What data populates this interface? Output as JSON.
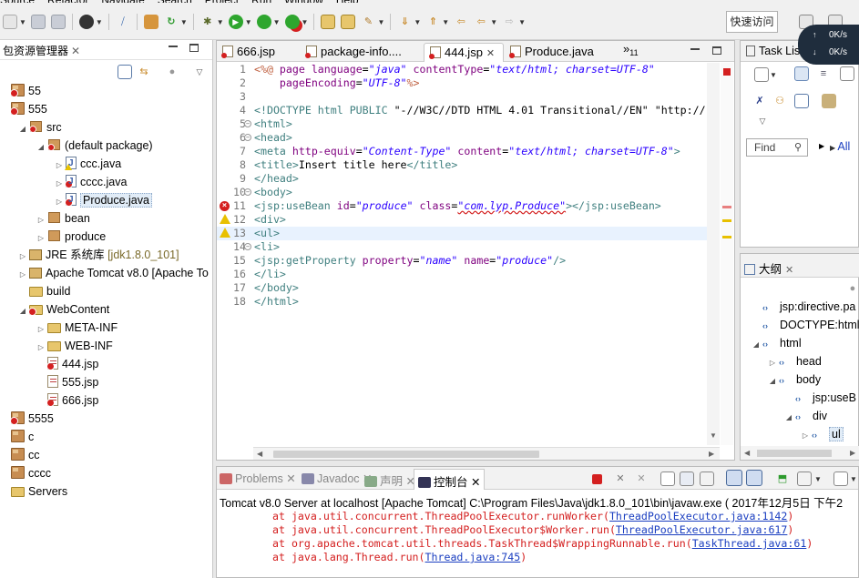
{
  "menu": [
    "Source",
    "Refactor",
    "Navigate",
    "Search",
    "Project",
    "Run",
    "Window",
    "Help"
  ],
  "quick_access": "快速访问",
  "netmon": {
    "up": "0K/s",
    "down": "0K/s"
  },
  "package_explorer": {
    "title": "包资源管理器",
    "tree": [
      {
        "label": "55",
        "indent": 0,
        "icon": "project-error",
        "twisty": ""
      },
      {
        "label": "555",
        "indent": 0,
        "icon": "project-error",
        "twisty": ""
      },
      {
        "label": "src",
        "indent": 1,
        "icon": "package-error",
        "twisty": "open"
      },
      {
        "label": "(default package)",
        "indent": 2,
        "icon": "package-error",
        "twisty": "open"
      },
      {
        "label": "ccc.java",
        "indent": 3,
        "icon": "java-warning",
        "twisty": "closed"
      },
      {
        "label": "cccc.java",
        "indent": 3,
        "icon": "java-error",
        "twisty": "closed"
      },
      {
        "label": "Produce.java",
        "indent": 3,
        "icon": "java-error",
        "twisty": "closed",
        "selected": true
      },
      {
        "label": "bean",
        "indent": 2,
        "icon": "package",
        "twisty": "closed"
      },
      {
        "label": "produce",
        "indent": 2,
        "icon": "package",
        "twisty": "closed"
      },
      {
        "label": "JRE 系统库",
        "suffix": "[jdk1.8.0_101]",
        "indent": 1,
        "icon": "library",
        "twisty": "closed"
      },
      {
        "label": "Apache Tomcat v8.0 [Apache To",
        "indent": 1,
        "icon": "library",
        "twisty": "closed"
      },
      {
        "label": "build",
        "indent": 1,
        "icon": "folder",
        "twisty": ""
      },
      {
        "label": "WebContent",
        "indent": 1,
        "icon": "folder-error",
        "twisty": "open"
      },
      {
        "label": "META-INF",
        "indent": 2,
        "icon": "folder",
        "twisty": "closed"
      },
      {
        "label": "WEB-INF",
        "indent": 2,
        "icon": "folder",
        "twisty": "closed"
      },
      {
        "label": "444.jsp",
        "indent": 2,
        "icon": "jsp-error",
        "twisty": ""
      },
      {
        "label": "555.jsp",
        "indent": 2,
        "icon": "jsp",
        "twisty": ""
      },
      {
        "label": "666.jsp",
        "indent": 2,
        "icon": "jsp-error",
        "twisty": ""
      },
      {
        "label": "5555",
        "indent": 0,
        "icon": "project-error",
        "twisty": ""
      },
      {
        "label": "c",
        "indent": 0,
        "icon": "project",
        "twisty": ""
      },
      {
        "label": "cc",
        "indent": 0,
        "icon": "project",
        "twisty": ""
      },
      {
        "label": "cccc",
        "indent": 0,
        "icon": "project",
        "twisty": ""
      },
      {
        "label": "Servers",
        "indent": 0,
        "icon": "folder",
        "twisty": ""
      }
    ]
  },
  "editor": {
    "tabs": [
      {
        "label": "666.jsp",
        "active": false
      },
      {
        "label": "package-info....",
        "active": false
      },
      {
        "label": "444.jsp",
        "active": true
      },
      {
        "label": "Produce.java",
        "active": false
      }
    ],
    "more_tabs": "»",
    "more_count": "11",
    "lines": [
      {
        "n": "1",
        "fold": false,
        "marker": "",
        "segs": [
          [
            "dir",
            "&lt;%@ "
          ],
          [
            "attr",
            "page "
          ],
          [
            "attr",
            "language"
          ],
          [
            "plain",
            "="
          ],
          [
            "val",
            "\"java\""
          ],
          [
            "plain",
            " "
          ],
          [
            "attr",
            "contentType"
          ],
          [
            "plain",
            "="
          ],
          [
            "val",
            "\"text/html; charset=UTF-8\""
          ]
        ]
      },
      {
        "n": "2",
        "fold": false,
        "marker": "",
        "segs": [
          [
            "plain",
            "    "
          ],
          [
            "attr",
            "pageEncoding"
          ],
          [
            "plain",
            "="
          ],
          [
            "val",
            "\"UTF-8\""
          ],
          [
            "dir",
            "%&gt;"
          ]
        ]
      },
      {
        "n": "3",
        "fold": false,
        "marker": "",
        "segs": []
      },
      {
        "n": "4",
        "fold": false,
        "marker": "",
        "segs": [
          [
            "doct",
            "&lt;!DOCTYPE html PUBLIC "
          ],
          [
            "plain",
            "\"-//W3C//DTD HTML 4.01 Transitional//EN\" \"http://"
          ]
        ]
      },
      {
        "n": "5",
        "fold": true,
        "marker": "",
        "segs": [
          [
            "tag",
            "&lt;html&gt;"
          ]
        ]
      },
      {
        "n": "6",
        "fold": true,
        "marker": "",
        "segs": [
          [
            "tag",
            "&lt;head&gt;"
          ]
        ]
      },
      {
        "n": "7",
        "fold": false,
        "marker": "",
        "segs": [
          [
            "tag",
            "&lt;meta "
          ],
          [
            "attr",
            "http-equiv"
          ],
          [
            "plain",
            "="
          ],
          [
            "val",
            "\"Content-Type\""
          ],
          [
            "plain",
            " "
          ],
          [
            "attr",
            "content"
          ],
          [
            "plain",
            "="
          ],
          [
            "val",
            "\"text/html; charset=UTF-8\""
          ],
          [
            "tag",
            "&gt;"
          ]
        ]
      },
      {
        "n": "8",
        "fold": false,
        "marker": "",
        "segs": [
          [
            "tag",
            "&lt;title&gt;"
          ],
          [
            "plain",
            "Insert title here"
          ],
          [
            "tag",
            "&lt;/title&gt;"
          ]
        ]
      },
      {
        "n": "9",
        "fold": false,
        "marker": "",
        "segs": [
          [
            "tag",
            "&lt;/head&gt;"
          ]
        ]
      },
      {
        "n": "10",
        "fold": true,
        "marker": "",
        "segs": [
          [
            "tag",
            "&lt;body&gt;"
          ]
        ]
      },
      {
        "n": "11",
        "fold": false,
        "marker": "error",
        "segs": [
          [
            "tag",
            "&lt;jsp:useBean "
          ],
          [
            "attr",
            "id"
          ],
          [
            "plain",
            "="
          ],
          [
            "val",
            "\"produce\""
          ],
          [
            "plain",
            " "
          ],
          [
            "attr",
            "class"
          ],
          [
            "plain",
            "="
          ],
          [
            "valsq",
            "\"com.lyp.Produce\""
          ],
          [
            "tag",
            "&gt;&lt;/jsp:useBean&gt;"
          ]
        ]
      },
      {
        "n": "12",
        "fold": false,
        "marker": "warning",
        "segs": [
          [
            "tag",
            "&lt;div&gt;"
          ]
        ]
      },
      {
        "n": "13",
        "fold": false,
        "marker": "warning",
        "current": true,
        "segs": [
          [
            "tag",
            "&lt;ul&gt;"
          ]
        ]
      },
      {
        "n": "14",
        "fold": true,
        "marker": "",
        "segs": [
          [
            "tag",
            "&lt;li&gt;"
          ]
        ]
      },
      {
        "n": "15",
        "fold": false,
        "marker": "",
        "segs": [
          [
            "tag",
            "&lt;jsp:getProperty "
          ],
          [
            "attr",
            "property"
          ],
          [
            "plain",
            "="
          ],
          [
            "val",
            "\"name\""
          ],
          [
            "plain",
            " "
          ],
          [
            "attr",
            "name"
          ],
          [
            "plain",
            "="
          ],
          [
            "val",
            "\"produce\""
          ],
          [
            "tag",
            "/&gt;"
          ]
        ]
      },
      {
        "n": "16",
        "fold": false,
        "marker": "",
        "segs": [
          [
            "tag",
            "&lt;/li&gt;"
          ]
        ]
      },
      {
        "n": "17",
        "fold": false,
        "marker": "",
        "segs": [
          [
            "tag",
            "&lt;/body&gt;"
          ]
        ]
      },
      {
        "n": "18",
        "fold": false,
        "marker": "",
        "segs": [
          [
            "tag",
            "&lt;/html&gt;"
          ]
        ]
      }
    ]
  },
  "task_list": {
    "title": "Task Lis",
    "find_placeholder": "Find",
    "all_label": "All"
  },
  "outline": {
    "title": "大纲",
    "tree": [
      {
        "label": "jsp:directive.pa",
        "indent": 0,
        "twisty": ""
      },
      {
        "label": "DOCTYPE:html",
        "indent": 0,
        "twisty": ""
      },
      {
        "label": "html",
        "indent": 0,
        "twisty": "open"
      },
      {
        "label": "head",
        "indent": 1,
        "twisty": "closed"
      },
      {
        "label": "body",
        "indent": 1,
        "twisty": "open"
      },
      {
        "label": "jsp:useB",
        "indent": 2,
        "twisty": ""
      },
      {
        "label": "div",
        "indent": 2,
        "twisty": "open"
      },
      {
        "label": "ul",
        "indent": 3,
        "twisty": "closed",
        "selected": true
      }
    ]
  },
  "console": {
    "tabs": [
      {
        "label": "Problems",
        "active": false
      },
      {
        "label": "Javadoc",
        "active": false
      },
      {
        "label": "声明",
        "active": false
      },
      {
        "label": "控制台",
        "active": true
      }
    ],
    "header": "Tomcat v8.0 Server at localhost [Apache Tomcat] C:\\Program Files\\Java\\jdk1.8.0_101\\bin\\javaw.exe ( 2017年12月5日 下午2",
    "stack": [
      {
        "text": "at java.util.concurrent.ThreadPoolExecutor.runWorker(",
        "link": "ThreadPoolExecutor.java:1142",
        "end": ")"
      },
      {
        "text": "at java.util.concurrent.ThreadPoolExecutor$Worker.run(",
        "link": "ThreadPoolExecutor.java:617",
        "end": ")"
      },
      {
        "text": "at org.apache.tomcat.util.threads.TaskThread$WrappingRunnable.run(",
        "link": "TaskThread.java:61",
        "end": ")"
      },
      {
        "text": "at java.lang.Thread.run(",
        "link": "Thread.java:745",
        "end": ")"
      }
    ]
  },
  "colors": {
    "error": "#d42020",
    "warning": "#e8c000",
    "link": "#1a3ec0",
    "selection": "#e1ecf7"
  }
}
